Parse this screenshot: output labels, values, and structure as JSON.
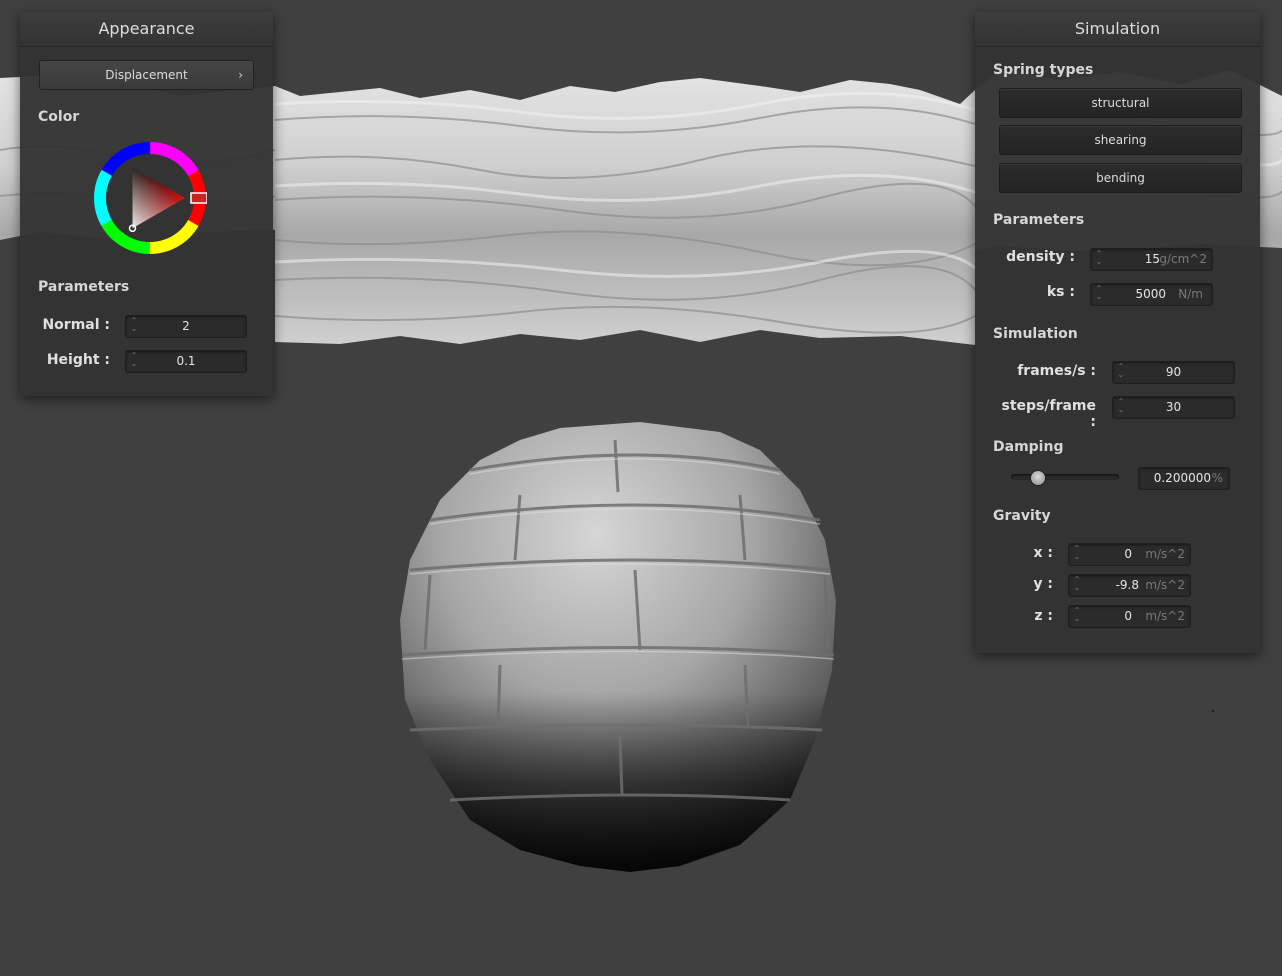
{
  "appearance": {
    "title": "Appearance",
    "displacement_button": "Displacement",
    "chevron": "›",
    "color_label": "Color",
    "color_wheel_icon": "color-wheel",
    "selected_color": "#c01818",
    "parameters_label": "Parameters",
    "normal_label": "Normal :",
    "normal_value": "2",
    "height_label": "Height :",
    "height_value": "0.1"
  },
  "simulation": {
    "title": "Simulation",
    "spring_types_label": "Spring types",
    "spring_buttons": [
      "structural",
      "shearing",
      "bending"
    ],
    "parameters_label": "Parameters",
    "density_label": "density :",
    "density_value": "15",
    "density_unit": "g/cm^2",
    "ks_label": "ks :",
    "ks_value": "5000",
    "ks_unit": "N/m",
    "simulation_label": "Simulation",
    "fps_label": "frames/s :",
    "fps_value": "90",
    "steps_label": "steps/frame :",
    "steps_value": "30",
    "damping_label": "Damping",
    "damping_slider": 0.2,
    "damping_value": "0.200000",
    "damping_unit": "%",
    "gravity_label": "Gravity",
    "gx_label": "x :",
    "gx_value": "0",
    "gy_label": "y :",
    "gy_value": "-9.8",
    "gz_label": "z :",
    "gz_value": "0",
    "gravity_unit": "m/s^2"
  },
  "colors": {
    "background": "#404040",
    "panel": "#333333",
    "cloth": "#c8c8c8",
    "sphere": "#9a9a9a"
  }
}
